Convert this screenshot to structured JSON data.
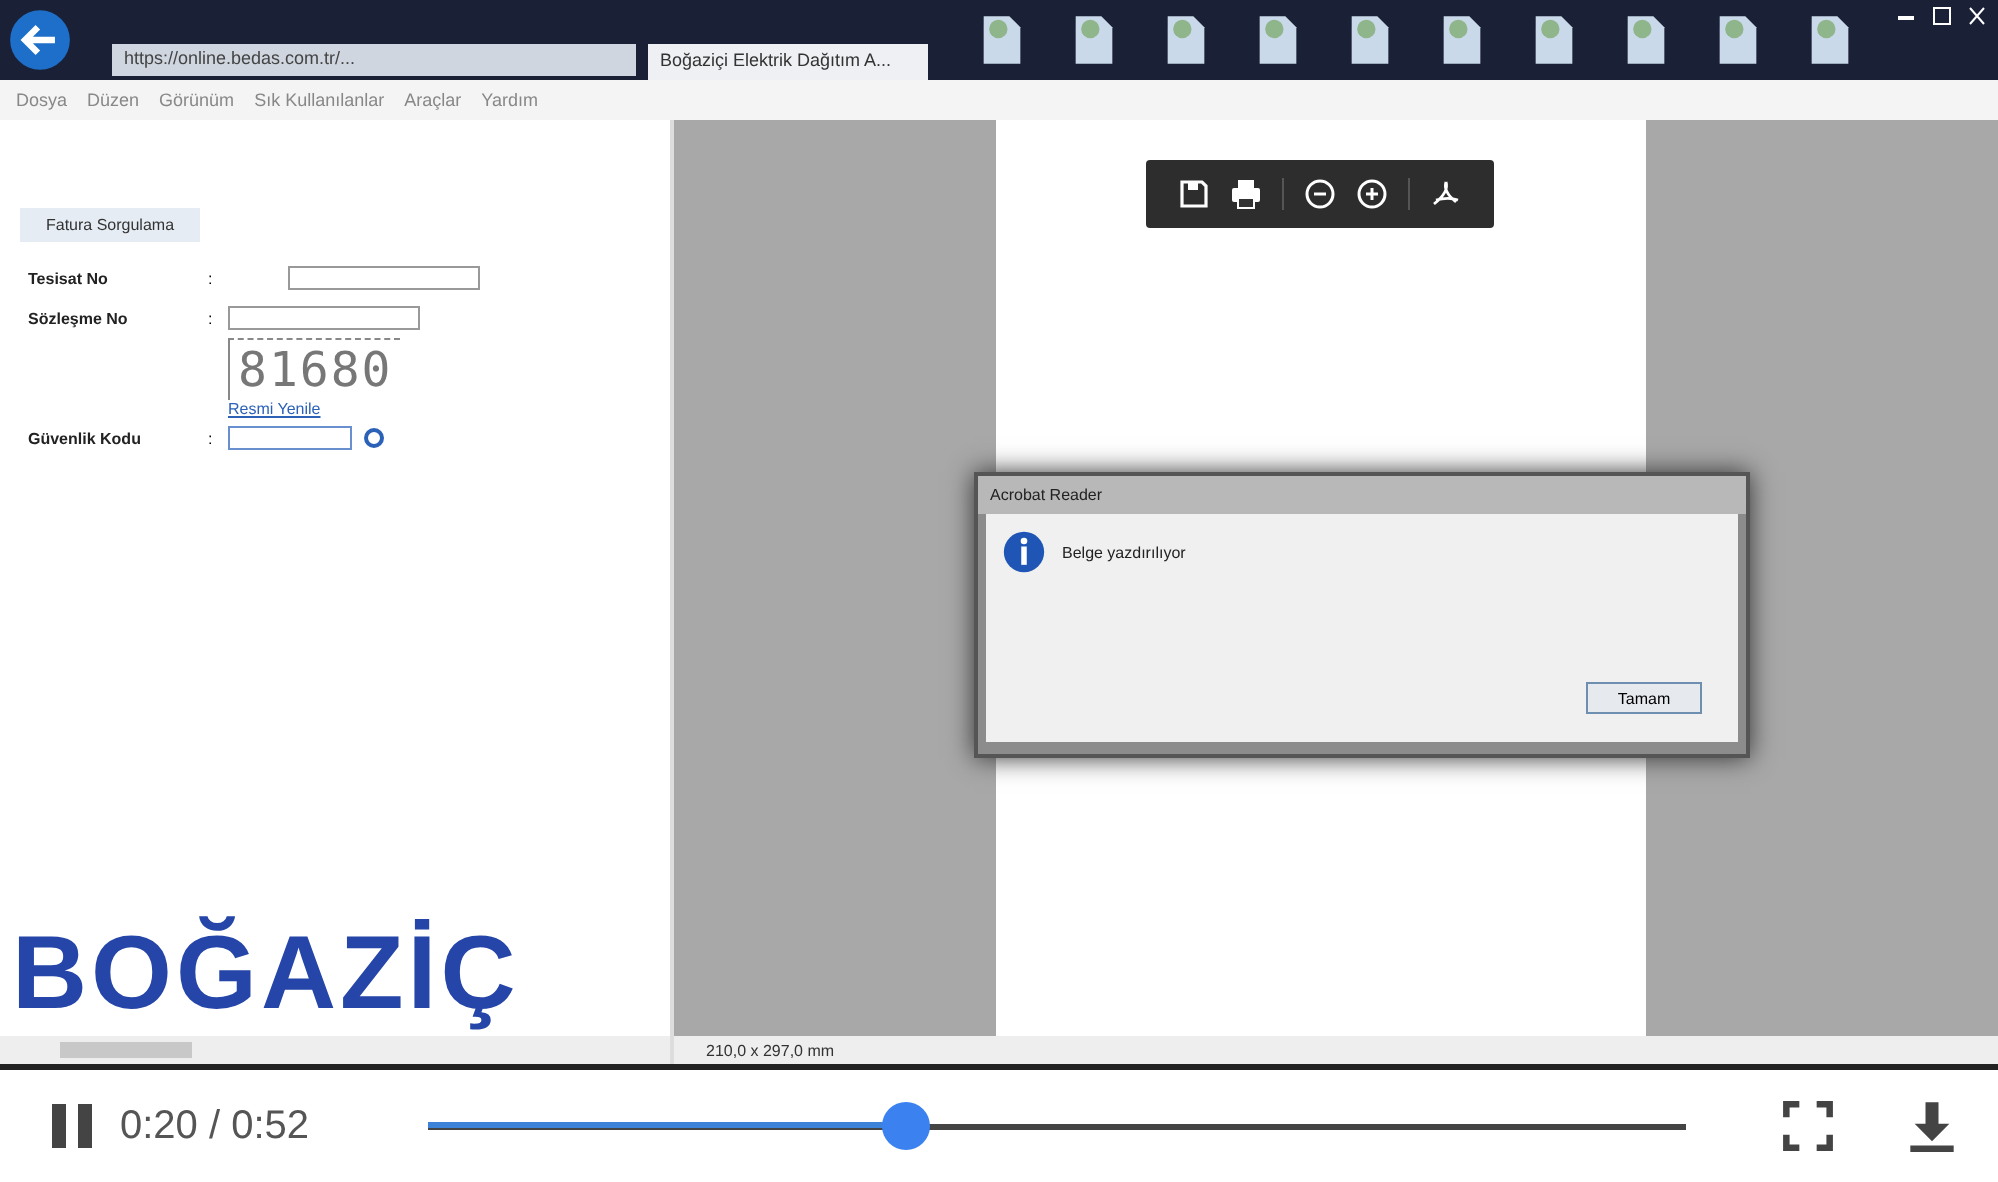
{
  "browser": {
    "address": "https://online.bedas.com.tr/...",
    "tab": {
      "title": "Boğaziçi Elektrik Dağıtım A..."
    },
    "menu": [
      "Dosya",
      "Düzen",
      "Görünüm",
      "Sık Kullanılanlar",
      "Araçlar",
      "Yardım"
    ]
  },
  "form": {
    "header": "Fatura Sorgulama",
    "fields": [
      {
        "label": "Tesisat No",
        "separator": ":",
        "kind": "wide"
      },
      {
        "label": "Sözleşme No",
        "separator": ":",
        "kind": "plain"
      },
      {
        "label": "Güvenlik Kodu",
        "separator": ":",
        "kind": "code"
      }
    ],
    "captcha": "81680",
    "refresh_link": "Resmi Yenile",
    "logo": "BOĞAZİÇ"
  },
  "viewer": {
    "page_size": "210,0 x 297,0 mm"
  },
  "dialog": {
    "title": "Acrobat Reader",
    "message": "Belge yazdırılıyor",
    "button": "Tamam"
  },
  "player": {
    "playing": true,
    "time": "0:20 / 0:52",
    "level": 0.38
  }
}
